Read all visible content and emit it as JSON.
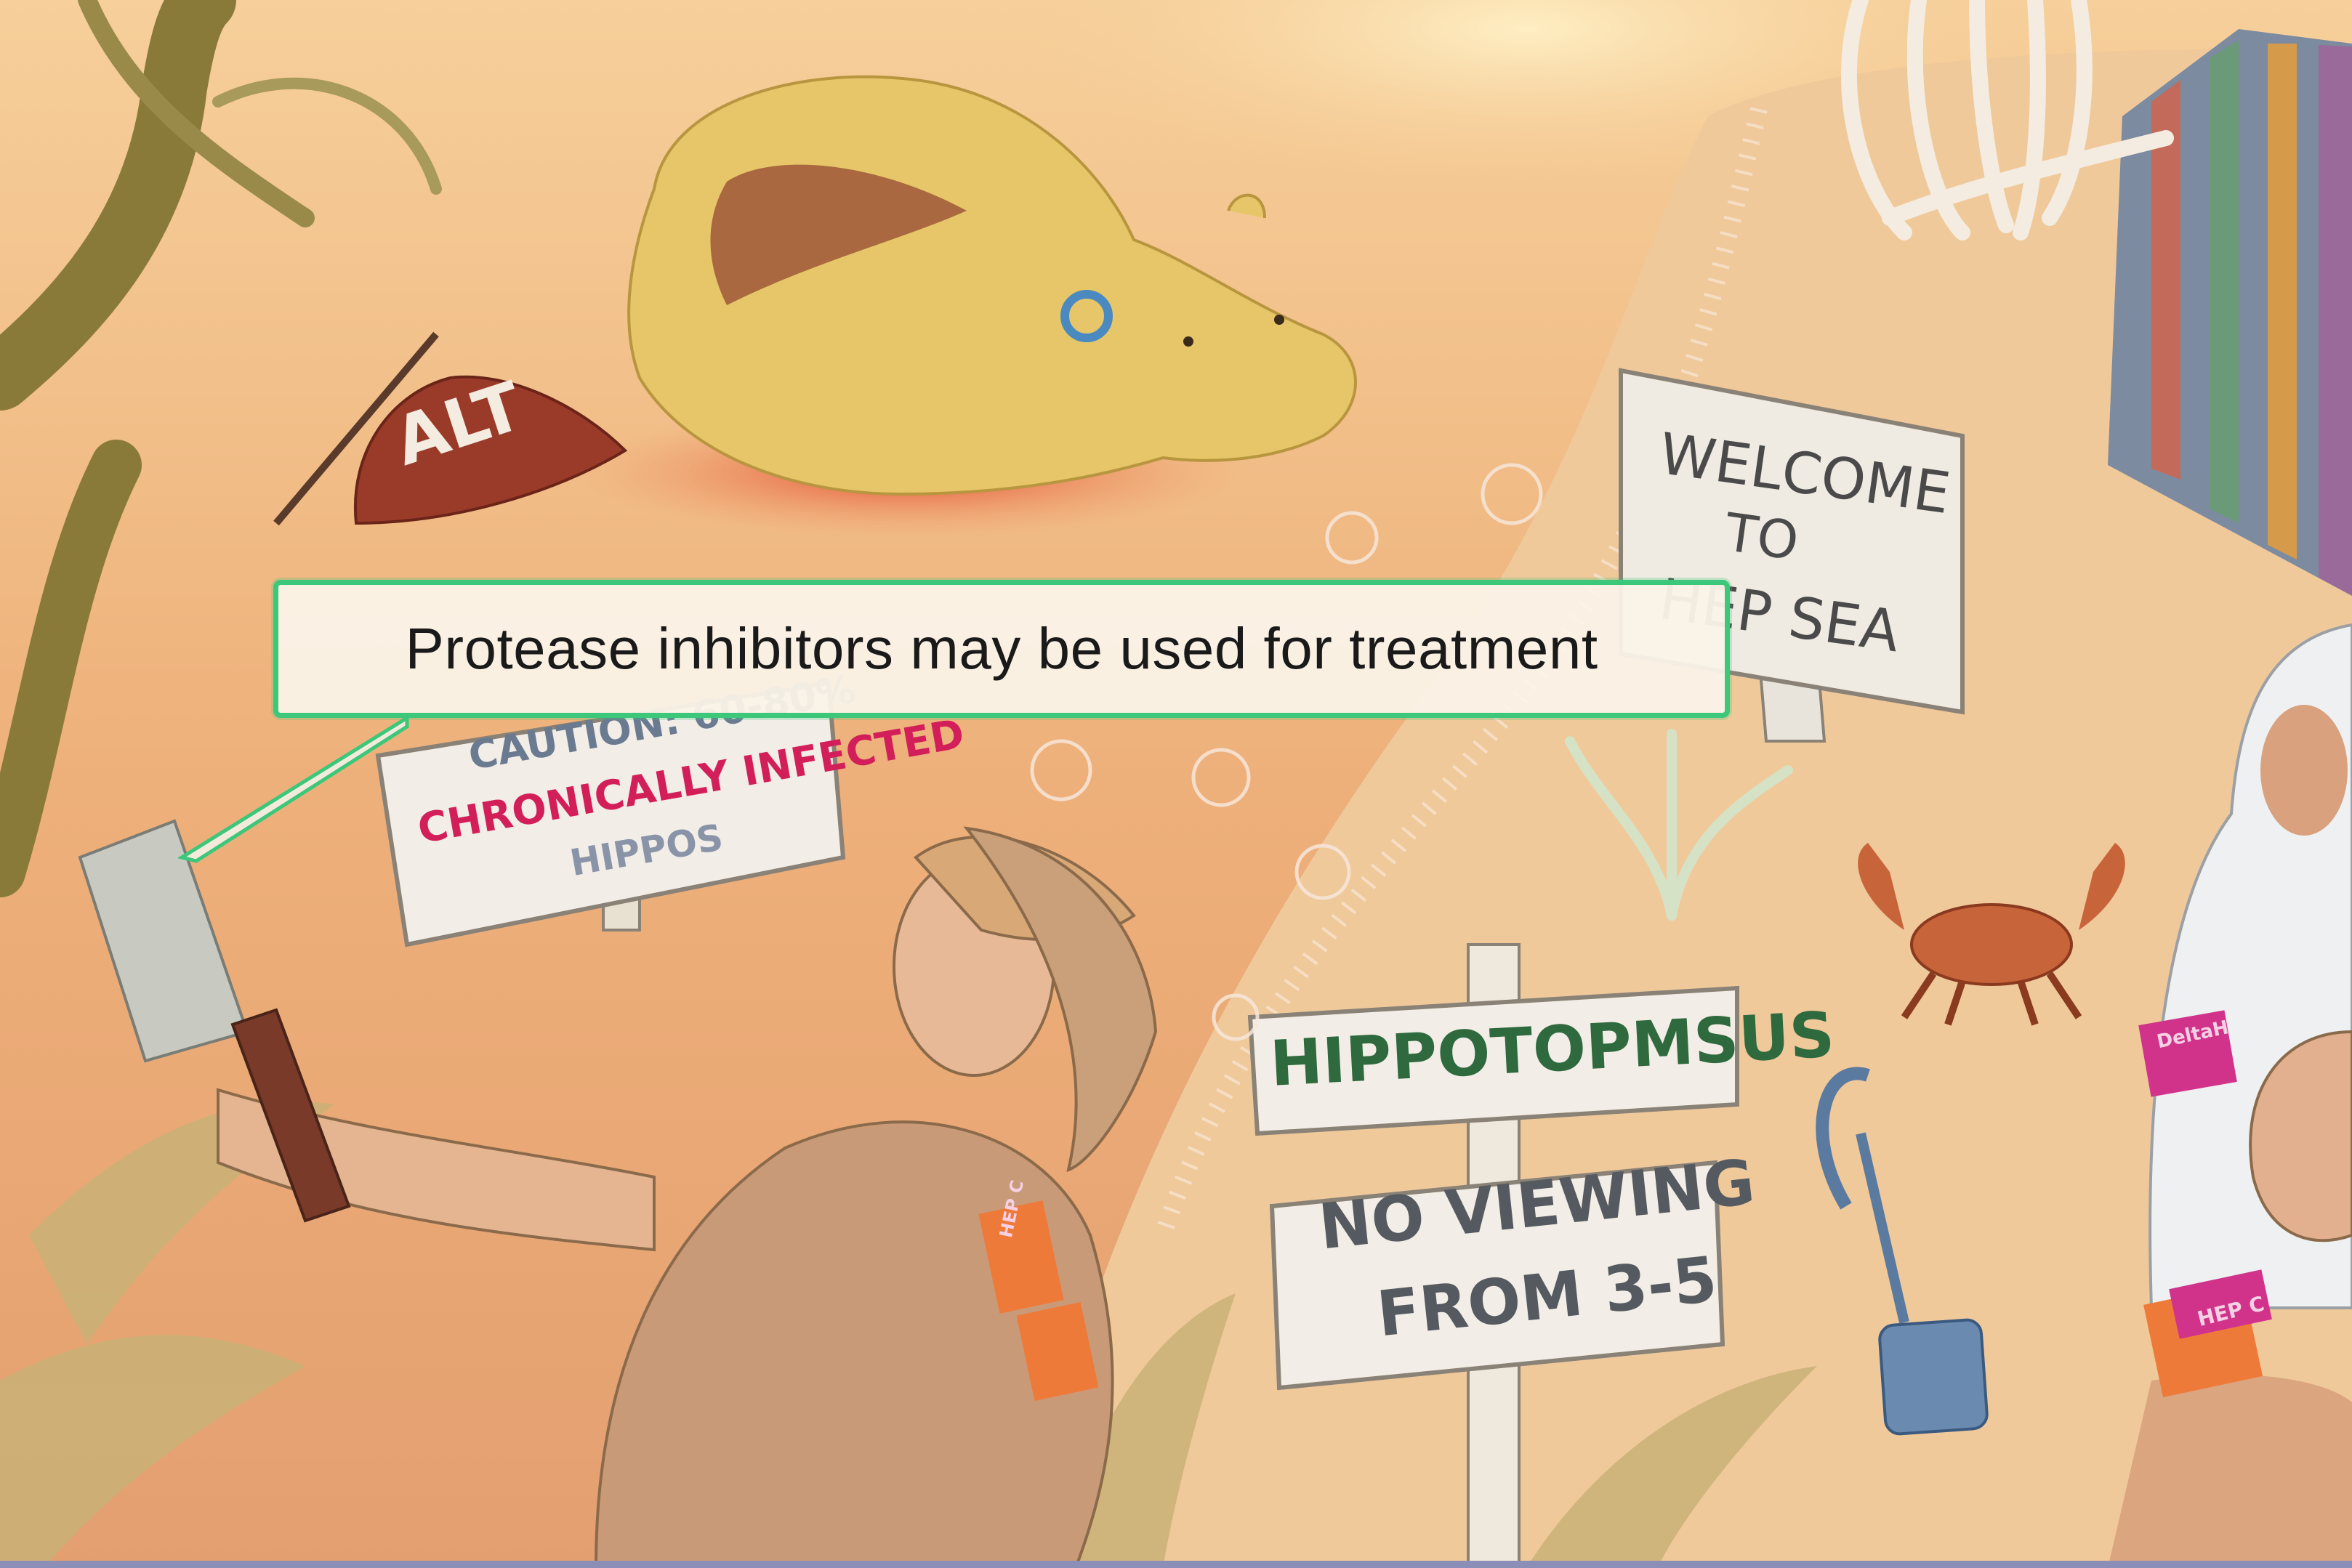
{
  "caption": {
    "text": "Protease inhibitors may be used for treatment"
  },
  "signs": {
    "alt_buoy": "ALT",
    "welcome_line1": "WELCOME",
    "welcome_line2": "TO",
    "welcome_line3": "HEP SEA",
    "caution_line1": "CAUTION: 60-80%",
    "caution_line2": "CHRONICALLY INFECTED",
    "caution_line3": "HIPPOS",
    "hippo_name": "HIPPOTOPMSUS",
    "viewing_line1": "NO VIEWING",
    "viewing_line2": "FROM 3-5"
  },
  "juice_boxes": {
    "label_a": "HEP C",
    "label_b": "DeltaH"
  },
  "colors": {
    "caption_border": "#3cc77a",
    "sky_top": "#f3c590",
    "sea": "#e9a56c",
    "sand": "#efc99a",
    "hippo": "#e5c567",
    "blood": "#e0503a",
    "tree": "#8a7a3a"
  }
}
